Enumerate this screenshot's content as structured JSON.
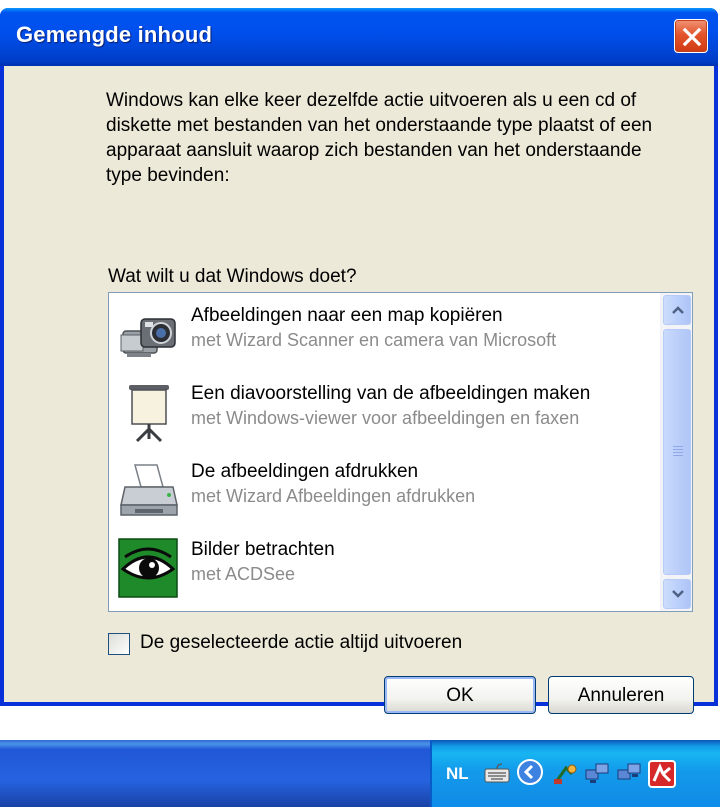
{
  "window": {
    "title": "Gemengde inhoud",
    "close_icon": "close-x-icon"
  },
  "description": "Windows kan elke keer dezelfde actie uitvoeren als u een cd of diskette met bestanden van het onderstaande type plaatst of een apparaat aansluit waarop zich bestanden van het onderstaande type bevinden:",
  "question": "Wat wilt u dat Windows doet?",
  "actions": [
    {
      "title": "Afbeeldingen naar een map kopiëren",
      "subtitle": "met Wizard Scanner en camera van Microsoft",
      "icon": "camera-icon"
    },
    {
      "title": "Een diavoorstelling van de afbeeldingen maken",
      "subtitle": "met Windows-viewer voor afbeeldingen en faxen",
      "icon": "projector-screen-icon"
    },
    {
      "title": "De afbeeldingen afdrukken",
      "subtitle": "met Wizard Afbeeldingen afdrukken",
      "icon": "printer-icon"
    },
    {
      "title": "Bilder betrachten",
      "subtitle": "met ACDSee",
      "icon": "eye-icon"
    }
  ],
  "always_checkbox": {
    "label": "De geselecteerde actie altijd uitvoeren",
    "checked": false
  },
  "buttons": {
    "ok": "OK",
    "cancel": "Annuleren"
  },
  "taskbar": {
    "language": "NL"
  },
  "colors": {
    "title_bar": "#0050ee",
    "dialog_bg": "#ece9d8",
    "close_button": "#e4552b",
    "tray": "#139beb"
  }
}
